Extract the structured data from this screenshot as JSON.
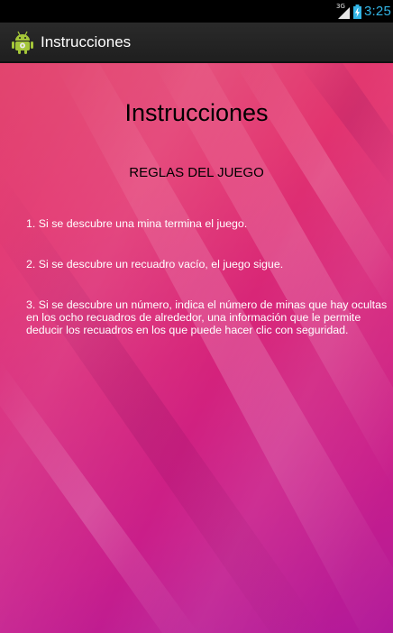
{
  "status_bar": {
    "network_label": "3G",
    "time": "3:25"
  },
  "action_bar": {
    "title": "Instrucciones",
    "icon": "android-robot-icon"
  },
  "content": {
    "title": "Instrucciones",
    "rules_heading": "REGLAS DEL JUEGO",
    "rules": [
      "1. Si se descubre una mina termina el juego.",
      "2. Si se descubre un recuadro vacío, el juego sigue.",
      "3. Si se descubre un número, indica el número de minas que hay ocultas en los ocho recuadros de alrededor, una información que le permite deducir los recuadros en los que puede hacer clic con seguridad."
    ]
  },
  "colors": {
    "clock": "#33b5e5",
    "background_top": "#e2456e",
    "background_bottom": "#b21a9a"
  }
}
